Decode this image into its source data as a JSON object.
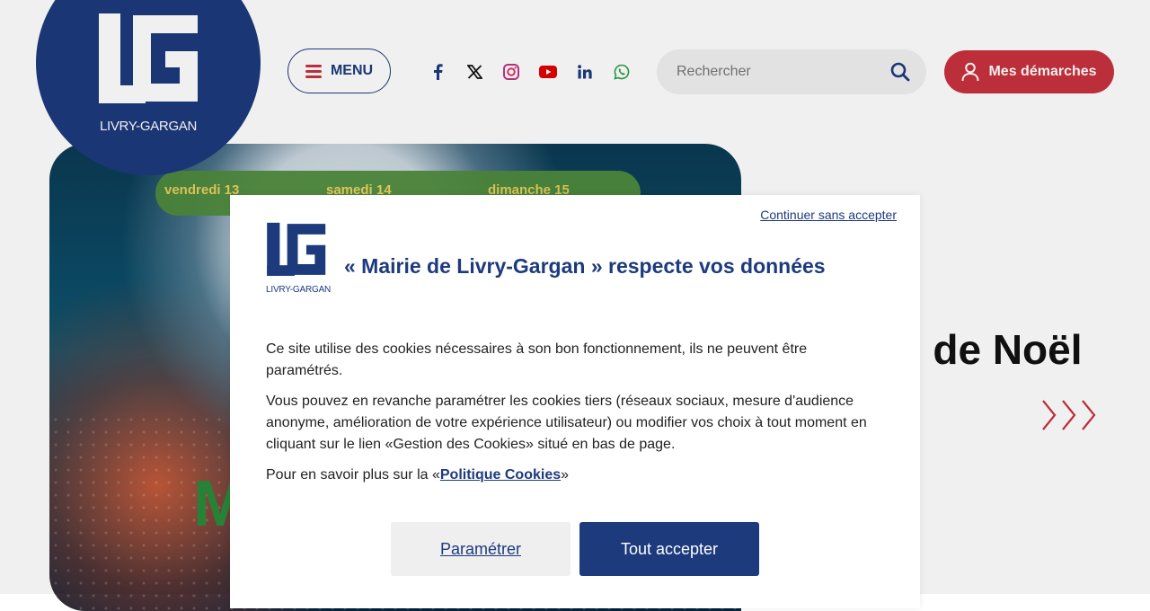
{
  "header": {
    "logo_text": "LIVRY-GARGAN",
    "menu_label": "MENU",
    "socials": [
      "facebook-icon",
      "x-twitter-icon",
      "instagram-icon",
      "youtube-icon",
      "linkedin-icon",
      "whatsapp-icon"
    ],
    "search_placeholder": "Rechercher",
    "demarches_label": "Mes démarches"
  },
  "hero": {
    "banner_days": [
      "vendredi 13",
      "samedi 14",
      "dimanche 15"
    ],
    "right_title": "é de Noël"
  },
  "cookie_modal": {
    "skip_label": "Continuer sans accepter",
    "logo_text": "LIVRY-GARGAN",
    "title": "« Mairie de Livry-Gargan » respecte vos données",
    "para1": "Ce site utilise des cookies nécessaires à son bon fonctionnement, ils ne peuvent être paramétrés.",
    "para2": "Vous pouvez en revanche paramétrer les cookies tiers (réseaux sociaux, mesure d'audience anonyme, amélioration de votre expérience utilisateur) ou modifier vos choix à tout moment en cliquant sur le lien «Gestion des Cookies» situé en bas de page.",
    "para3_prefix": "Pour en savoir plus sur la «",
    "para3_link": "Politique Cookies",
    "para3_suffix": "»",
    "param_label": "Paramétrer",
    "accept_label": "Tout accepter"
  },
  "colors": {
    "brand_blue": "#1d3a7d",
    "brand_red": "#c8313d"
  }
}
